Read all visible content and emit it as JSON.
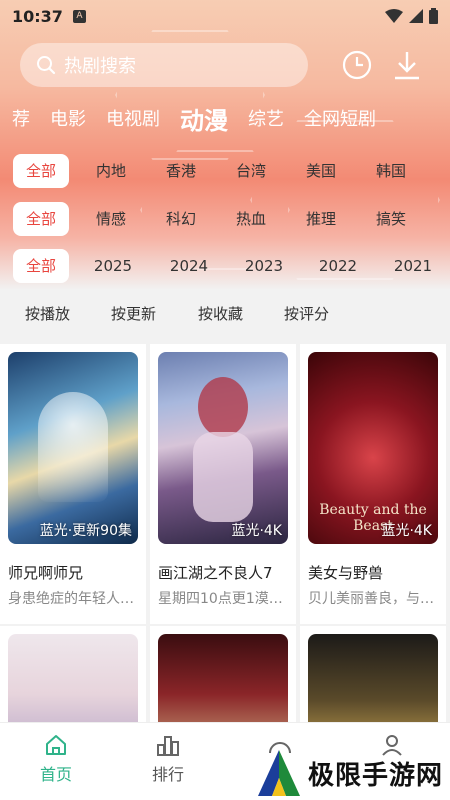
{
  "status_bar": {
    "time": "10:37",
    "notification_icon": "A"
  },
  "header": {
    "search_placeholder": "热剧搜索",
    "history_icon": "clock-icon",
    "download_icon": "download-icon"
  },
  "categories": [
    {
      "label": "荐",
      "active": false
    },
    {
      "label": "电影",
      "active": false
    },
    {
      "label": "电视剧",
      "active": false
    },
    {
      "label": "动漫",
      "active": true
    },
    {
      "label": "综艺",
      "active": false
    },
    {
      "label": "全网短剧",
      "active": false
    }
  ],
  "filters": {
    "region": [
      "全部",
      "内地",
      "香港",
      "台湾",
      "美国",
      "韩国"
    ],
    "genre": [
      "全部",
      "情感",
      "科幻",
      "热血",
      "推理",
      "搞笑"
    ],
    "year": [
      "全部",
      "2025",
      "2024",
      "2023",
      "2022",
      "2021"
    ]
  },
  "sort_options": [
    "按播放",
    "按更新",
    "按收藏",
    "按评分"
  ],
  "cards": [
    {
      "title": "师兄啊师兄",
      "desc": "身患绝症的年轻人李长寿…",
      "badge": "蓝光·更新90集"
    },
    {
      "title": "画江湖之不良人7",
      "desc": "星期四10点更1漠北…",
      "badge": "蓝光·4K"
    },
    {
      "title": "美女与野兽",
      "desc": "贝儿美丽善良，与…",
      "badge": "蓝光·4K",
      "poster_text": "Beauty and the Beast"
    }
  ],
  "tabbar": [
    {
      "label": "首页",
      "active": true,
      "icon": "home-icon"
    },
    {
      "label": "排行",
      "active": false,
      "icon": "ranking-icon"
    },
    {
      "label": "",
      "active": false,
      "icon": "discover-icon"
    },
    {
      "label": "",
      "active": false,
      "icon": "user-icon"
    }
  ],
  "watermark": {
    "text": "极限手游网"
  },
  "colors": {
    "accent": "#e8463f",
    "tab_active": "#2fb38a"
  }
}
